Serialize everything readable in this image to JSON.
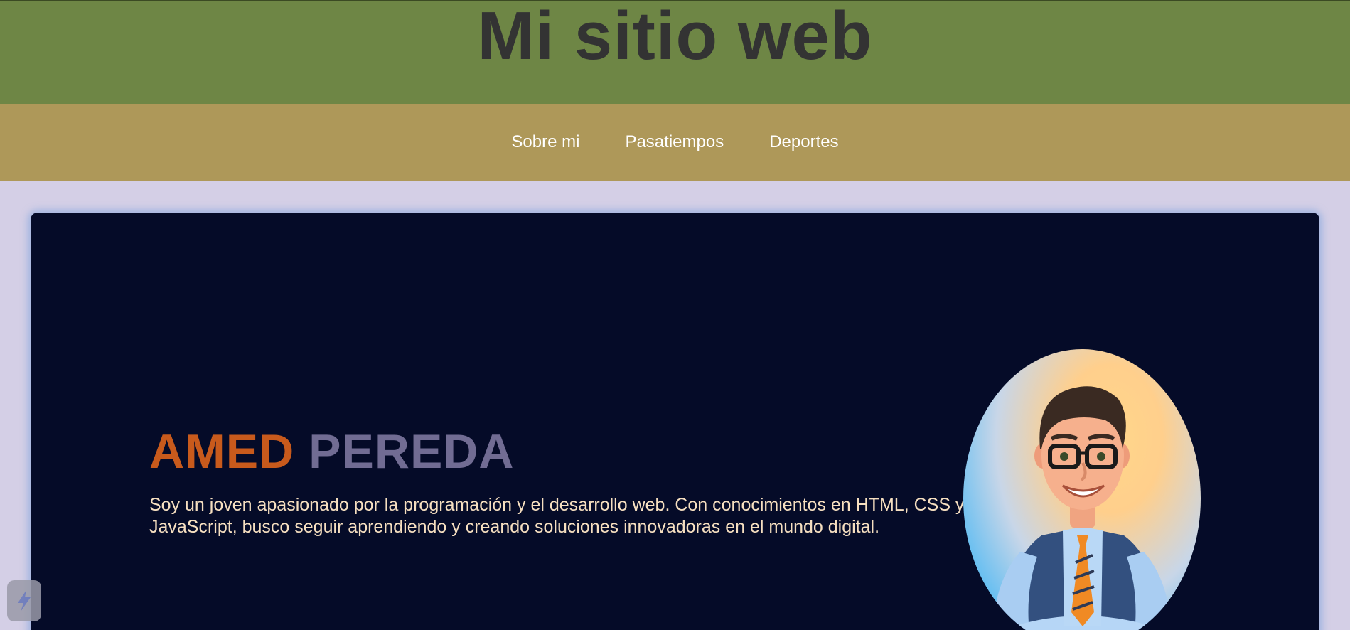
{
  "header": {
    "title": "Mi sitio web"
  },
  "nav": {
    "items": [
      {
        "label": "Sobre mi"
      },
      {
        "label": "Pasatiempos"
      },
      {
        "label": "Deportes"
      }
    ]
  },
  "profile": {
    "first_name": "AMED",
    "last_name": "PEREDA",
    "bio": "Soy un joven apasionado por la programación y el desarrollo web. Con conocimientos en HTML, CSS y JavaScript, busco seguir aprendiendo y creando soluciones innovadoras en el mundo digital.",
    "avatar_icon": "cartoon-man-portrait"
  },
  "colors": {
    "header_bg": "#6e8645",
    "nav_bg": "#ae9859",
    "page_bg": "#d4cfe6",
    "card_bg": "#050b28",
    "first_name": "#c85a1c",
    "last_name": "#716c93",
    "bio_text": "#f6dfc0"
  },
  "floating_button": {
    "icon": "lightning-icon"
  }
}
